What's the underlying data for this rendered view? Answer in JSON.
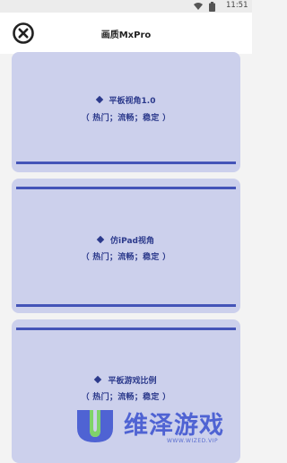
{
  "status_bar": {
    "time": "11:51"
  },
  "header": {
    "title": "画质MxPro",
    "close_icon": "close-circle-icon"
  },
  "options": [
    {
      "name": "平板视角1.0",
      "tags": "（ 热门；流畅；稳定 ）"
    },
    {
      "name": "仿iPad视角",
      "tags": "（ 热门；流畅；稳定 ）"
    },
    {
      "name": "平板游戏比例",
      "tags": "（ 热门；流畅；稳定 ）"
    }
  ],
  "watermark": {
    "name": "维泽游戏",
    "url": "WWW.WIZED.VIP"
  },
  "colors": {
    "card_bg": "#ccd0ec",
    "accent": "#4454b8",
    "text": "#2c3a8c"
  }
}
